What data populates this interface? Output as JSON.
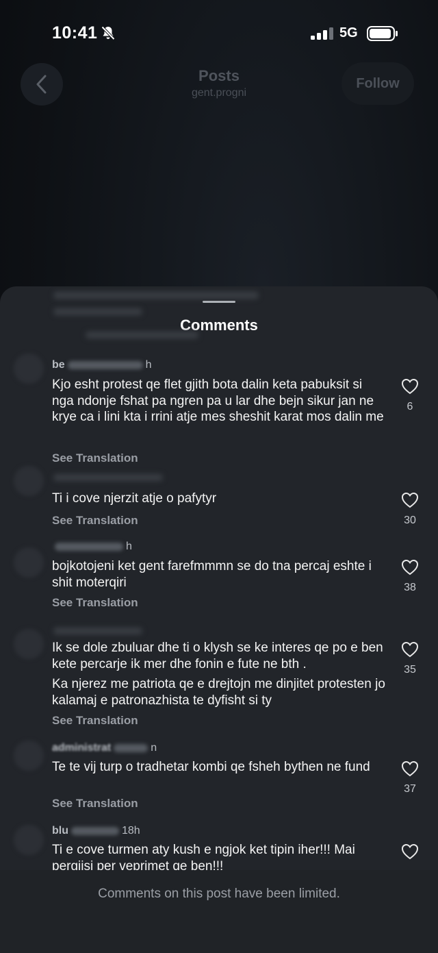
{
  "status": {
    "time": "10:41",
    "network": "5G"
  },
  "nav": {
    "title": "Posts",
    "subtitle": "gent.progni",
    "follow_label": "Follow"
  },
  "sheet": {
    "title": "Comments"
  },
  "comments": [
    {
      "user": "be",
      "user_suffix": "h",
      "text": "Kjo esht protest qe flet gjith bota dalin keta pabuksit si nga ndonje fshat pa ngren pa u lar dhe bejn sikur jan ne krye ca i lini kta i rrini atje mes sheshit karat mos dalin me",
      "translate": "See Translation",
      "likes": "6"
    },
    {
      "user": "",
      "user_suffix": "",
      "text": "Ti i cove njerzit atje o pafytyr",
      "translate": "See Translation",
      "likes": "30"
    },
    {
      "user": "",
      "user_suffix": "h",
      "text": "bojkotojeni ket gent farefmmmn se do tna percaj eshte i shit moterqiri",
      "translate": "See Translation",
      "likes": "38"
    },
    {
      "user": "",
      "user_suffix": "",
      "text": "Ik se dole zbuluar dhe ti o klysh se ke interes qe po e ben kete percarje ik mer dhe fonin e fute ne bth .",
      "text2": "Ka njerez me patriota qe e drejtojn me dinjitet protesten jo kalamaj e patronazhista te dyfisht si ty",
      "translate": "See Translation",
      "likes": "35"
    },
    {
      "user": "administrat",
      "user_suffix": "n",
      "text": "Te te vij turp o tradhetar kombi qe fsheh bythen ne fund",
      "translate": "See Translation",
      "likes": "37"
    },
    {
      "user": "blu",
      "user_suffix": "18h",
      "text": "Ti e cove turmen aty kush e ngjok ket tipin iher!!! Mai pergjisi per veprimet qe ben!!!",
      "translate": "",
      "likes": ""
    }
  ],
  "footer": {
    "text": "Comments on this post have been limited."
  }
}
